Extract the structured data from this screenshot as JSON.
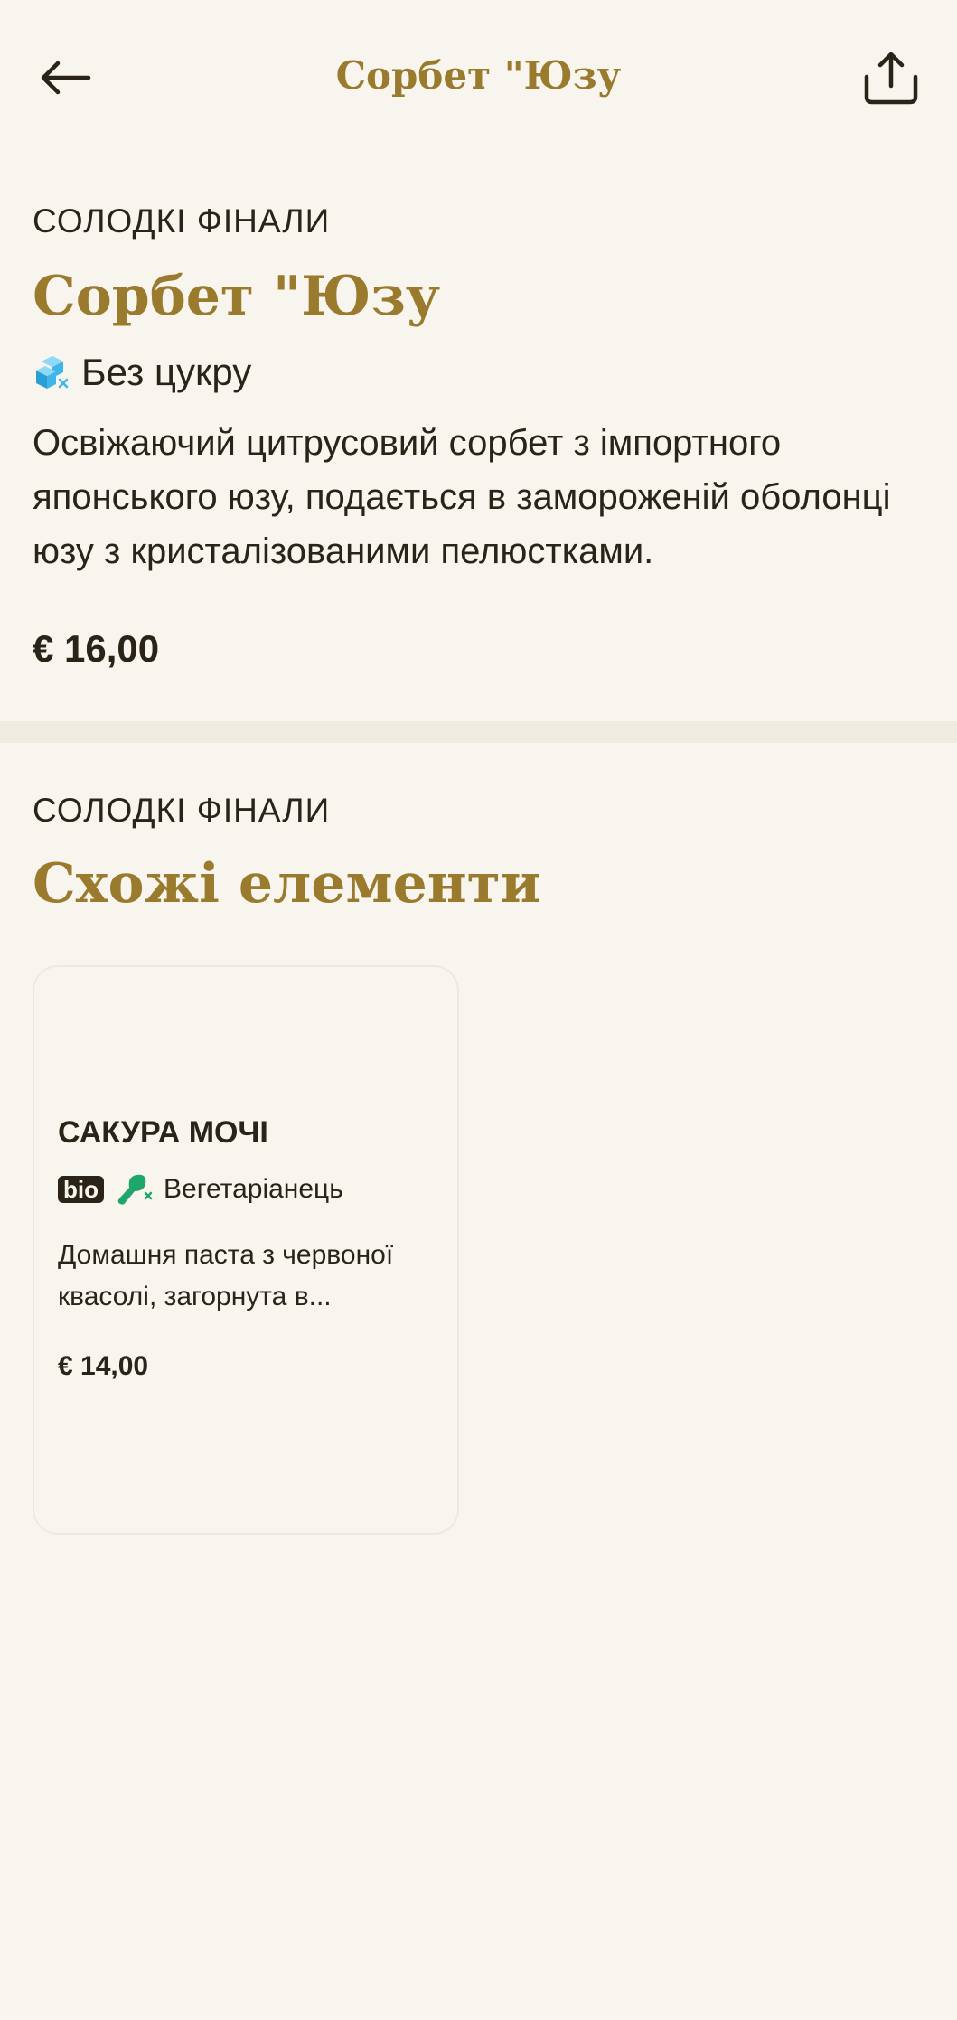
{
  "header": {
    "title": "Сорбет \"Юзу",
    "back_icon": "arrow-left-icon",
    "share_icon": "share-icon"
  },
  "item": {
    "category": "СОЛОДКІ ФІНАЛИ",
    "name": "Сорбет \"Юзу",
    "diet_label": "Без цукру",
    "diet_icon": "sugar-free-icon",
    "description": "Освіжаючий цитрусовий сорбет з імпортного японського юзу, подається в замороженій оболонці юзу з кристалізованими пелюстками.",
    "price": "€ 16,00"
  },
  "similar": {
    "category": "СОЛОДКІ ФІНАЛИ",
    "heading": "Схожі елементи",
    "items": [
      {
        "name": "САКУРА МОЧІ",
        "badge": "bio",
        "diet_icon": "vegetarian-icon",
        "diet_label": "Вегетаріанець",
        "description": "Домашня паста з червоної квасолі, загорнута в...",
        "price": "€ 14,00"
      }
    ]
  },
  "colors": {
    "background": "#f8f5ef",
    "accent_gold": "#9a7b2d",
    "text_dark": "#2a2418",
    "sugar_free_blue": "#3fb6ea",
    "vegetarian_green": "#1fa66a"
  }
}
